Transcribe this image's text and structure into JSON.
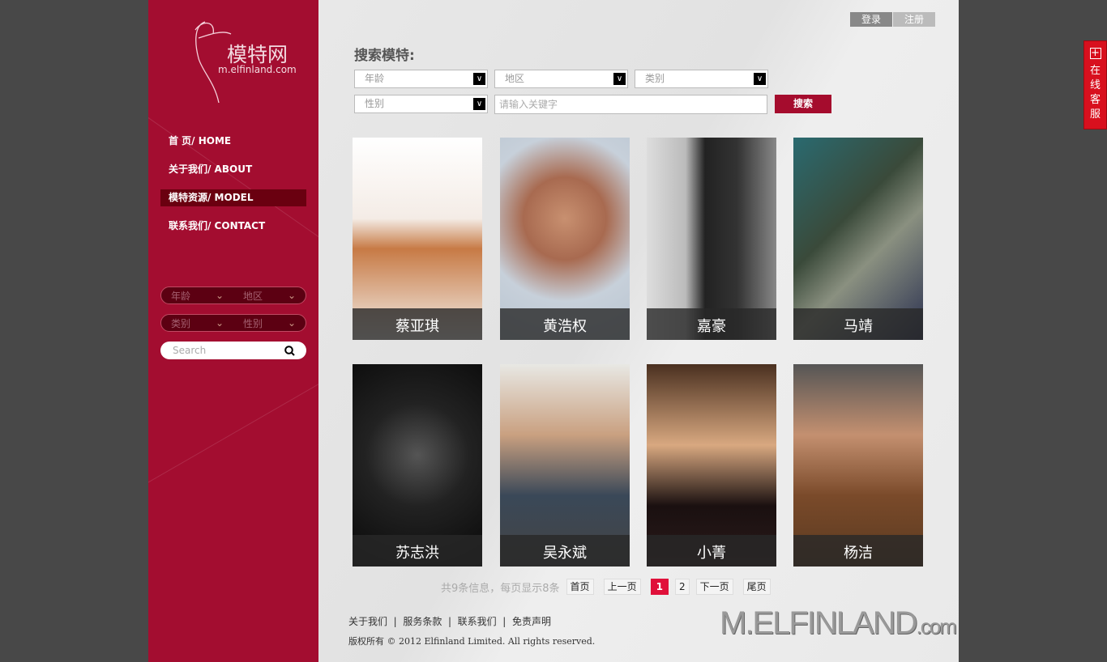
{
  "logo": {
    "cn": "模特网",
    "en": "m.elfinland.com"
  },
  "nav": [
    {
      "label": "首 页/  HOME"
    },
    {
      "label": "关于我们/  ABOUT"
    },
    {
      "label": "模特资源/  MODEL"
    },
    {
      "label": "联系我们/  CONTACT"
    }
  ],
  "sidebar_filters": {
    "age": "年龄",
    "region": "地区",
    "category": "类别",
    "gender": "性别",
    "search_placeholder": "Search"
  },
  "header": {
    "login": "登录",
    "register": "注册"
  },
  "search": {
    "title": "搜索模特:",
    "age": "年龄",
    "region": "地区",
    "category": "类别",
    "gender": "性别",
    "keyword_placeholder": "请输入关键字",
    "button": "搜索"
  },
  "models": [
    {
      "name": "蔡亚琪"
    },
    {
      "name": "黄浩权"
    },
    {
      "name": "嘉豪"
    },
    {
      "name": "马靖"
    },
    {
      "name": "苏志洪"
    },
    {
      "name": "吴永斌"
    },
    {
      "name": "小菁"
    },
    {
      "name": "杨洁"
    }
  ],
  "pagination": {
    "info": "共9条信息，每页显示8条",
    "first": "首页",
    "prev": "上一页",
    "pages": [
      "1",
      "2"
    ],
    "current": "1",
    "next": "下一页",
    "last": "尾页"
  },
  "footer": {
    "links": [
      "关于我们",
      "服务条款",
      "联系我们",
      "免责声明"
    ],
    "copyright": "版权所有 © 2012 Elfinland Limited. All rights reserved.",
    "logo": "M.ELFINLAND",
    "logo_suffix": ".com"
  },
  "kefu": {
    "label": "在线客服"
  },
  "colors": {
    "brand": "#a30d30",
    "active_page": "#e0103a"
  }
}
